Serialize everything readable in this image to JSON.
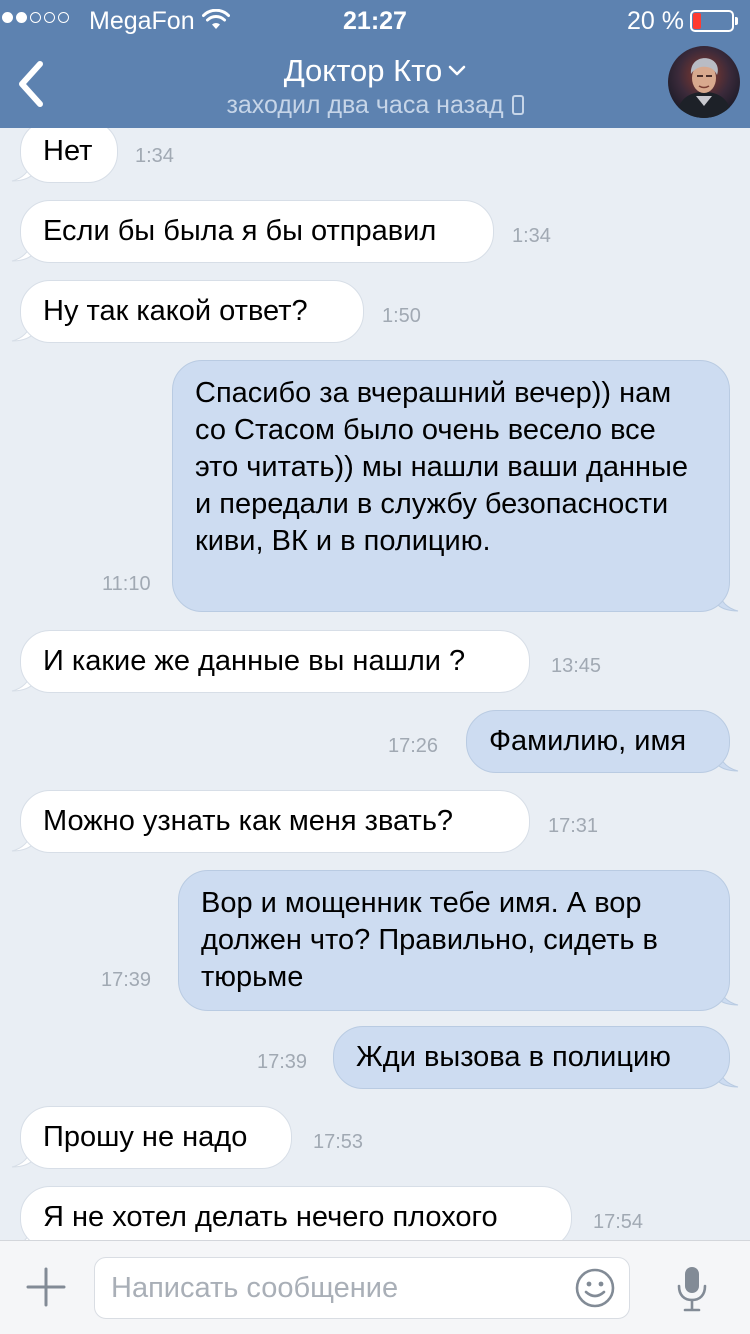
{
  "status_bar": {
    "carrier": "MegaFon",
    "signal_bars_filled": 2,
    "signal_bars_total": 5,
    "time": "21:27",
    "battery_percent_label": "20 %",
    "battery_level": 0.2,
    "battery_color": "#ff3b30",
    "wifi_icon": "wifi-icon"
  },
  "navbar": {
    "back_icon": "chevron-left-icon",
    "title": "Доктор Кто",
    "title_icon": "chevron-down-icon",
    "subtitle": "заходил два часа назад",
    "subtitle_icon": "mobile-phone-icon",
    "avatar": "avatar",
    "bar_color": "#5d82b0"
  },
  "messages": [
    {
      "dir": "in",
      "text": "Нет",
      "time": "1:34"
    },
    {
      "dir": "in",
      "text": "Если бы была я бы отправил",
      "time": "1:34"
    },
    {
      "dir": "in",
      "text": "Ну так какой ответ?",
      "time": "1:50"
    },
    {
      "dir": "out",
      "text": "Спасибо за вчерашний вечер)) нам со Стасом было очень весело все это читать)) мы нашли ваши данные и передали в службу безопасности киви, ВК и в полицию.",
      "time": "11:10"
    },
    {
      "dir": "in",
      "text": "И какие же данные вы нашли ?",
      "time": "13:45"
    },
    {
      "dir": "out",
      "text": "Фамилию, имя",
      "time": "17:26"
    },
    {
      "dir": "in",
      "text": "Можно узнать как меня звать?",
      "time": "17:31"
    },
    {
      "dir": "out",
      "text": "Вор и мощенник тебе имя. А вор должен что? Правильно, сидеть в тюрьме",
      "time": "17:39"
    },
    {
      "dir": "out",
      "text": "Жди вызова в полицию",
      "time": "17:39"
    },
    {
      "dir": "in",
      "text": "Прошу не надо",
      "time": "17:53"
    },
    {
      "dir": "in",
      "text": "Я не хотел делать нечего плохого",
      "time": "17:54"
    }
  ],
  "composer": {
    "attach_icon": "plus-icon",
    "placeholder": "Написать сообщение",
    "value": "",
    "emoji_icon": "smiley-icon",
    "mic_icon": "microphone-icon"
  },
  "colors": {
    "chat_background": "#e9eef4",
    "incoming_bubble": "#ffffff",
    "outgoing_bubble": "#cddcf1",
    "timestamp": "#a1a9b3"
  }
}
